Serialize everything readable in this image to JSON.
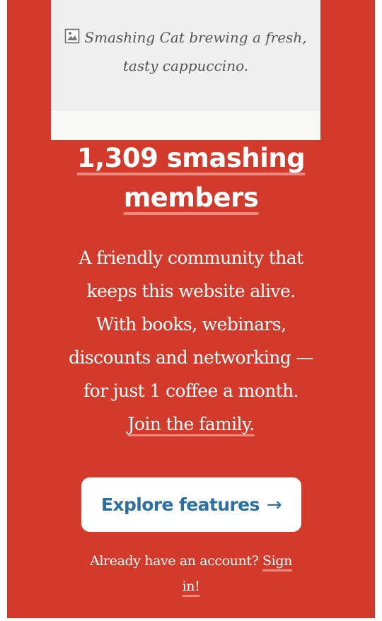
{
  "image": {
    "alt_text": "Smashing Cat brewing a fresh, tasty cappuccino.",
    "icon": "broken-image-icon"
  },
  "headline": {
    "line1": "1,309 smashing",
    "line2": "members"
  },
  "description": {
    "line1": "A friendly community that",
    "line2": "keeps this website alive.",
    "line3": "With books, webinars,",
    "line4": "discounts and networking —",
    "line5": "for just 1 coffee a month.",
    "join_link": "Join the family."
  },
  "cta": {
    "label": "Explore features",
    "arrow": "→"
  },
  "signin": {
    "prompt": "Already have an account?",
    "link": "Sign in!"
  },
  "colors": {
    "panel_bg": "#d33a2c",
    "accent_underline": "#f08a80",
    "button_text": "#2d6fa0"
  }
}
